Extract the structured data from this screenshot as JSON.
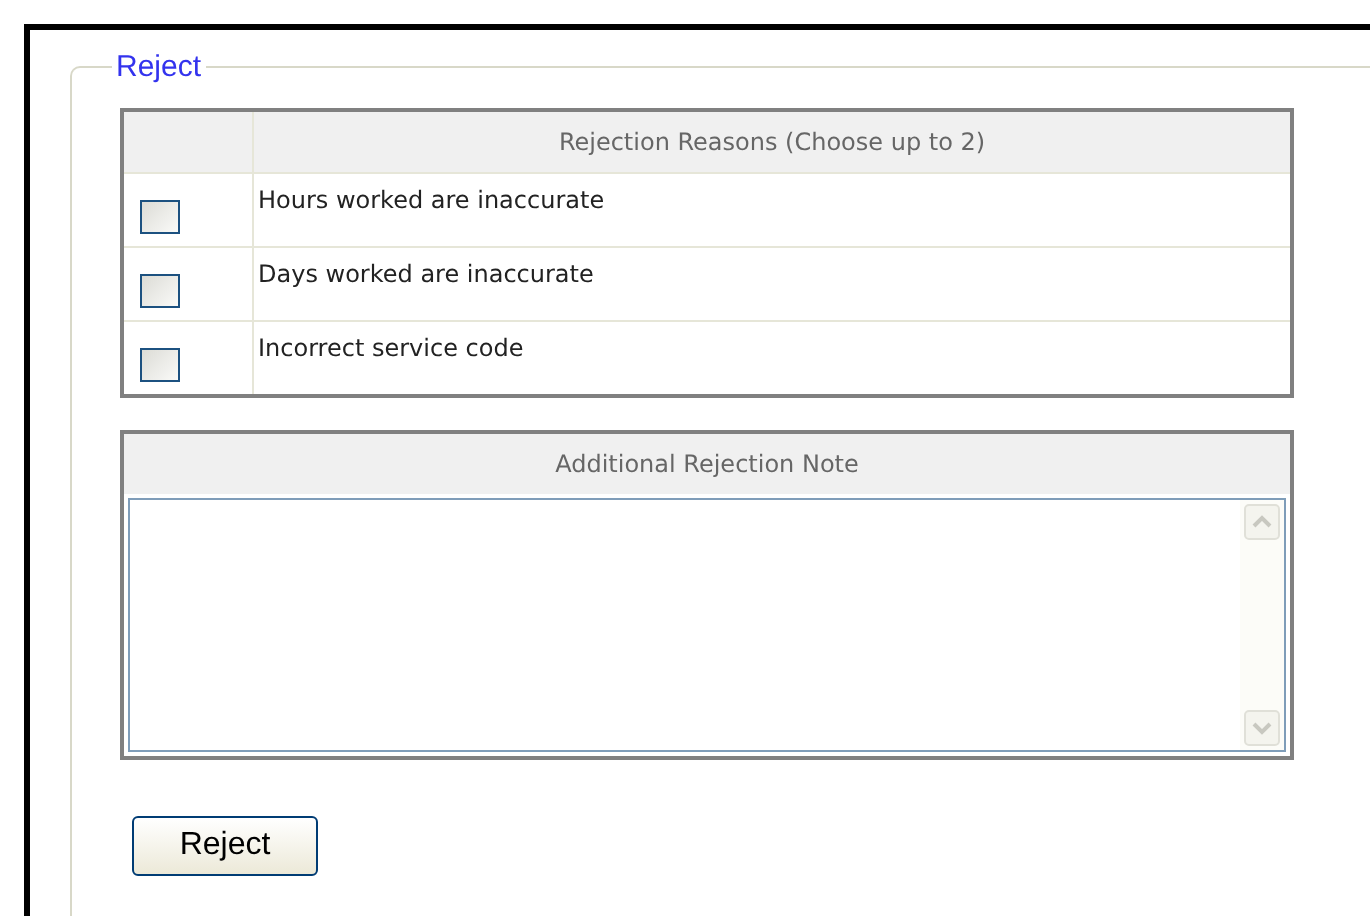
{
  "fieldset": {
    "legend": "Reject"
  },
  "reasons": {
    "header": "Rejection Reasons (Choose up to 2)",
    "rows": [
      {
        "label": "Hours worked are inaccurate",
        "checked": false
      },
      {
        "label": "Days worked are inaccurate",
        "checked": false
      },
      {
        "label": "Incorrect service code",
        "checked": false
      }
    ]
  },
  "note": {
    "header": "Additional Rejection Note"
  },
  "button": "Reject"
}
